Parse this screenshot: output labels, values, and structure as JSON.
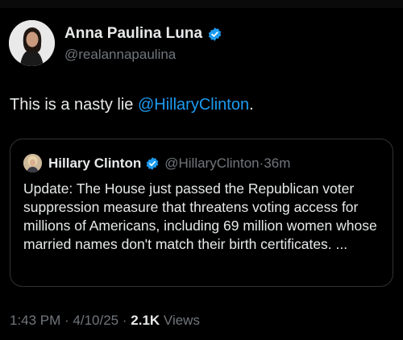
{
  "tweet": {
    "author_name": "Anna Paulina Luna",
    "author_handle": "@realannapaulina",
    "text_before": "This is a nasty lie ",
    "mention": "@HillaryClinton",
    "text_after": "."
  },
  "quote": {
    "author_name": "Hillary Clinton",
    "author_handle": "@HillaryClinton",
    "separator": " · ",
    "time": "36m",
    "text": "Update: The House just passed the Republican voter suppression measure that threatens voting access for millions of Americans, including 69 million women whose married names don't match their birth certificates. ..."
  },
  "footer": {
    "time": "1:43 PM",
    "separator1": " · ",
    "date": "4/10/25",
    "separator2": " · ",
    "views_count": "2.1K",
    "views_label": " Views"
  },
  "colors": {
    "link": "#1d9bf0",
    "verified": "#1d9bf0",
    "muted": "#71767b",
    "background": "#000000"
  },
  "icons": {
    "verified": "verified-badge-icon"
  }
}
